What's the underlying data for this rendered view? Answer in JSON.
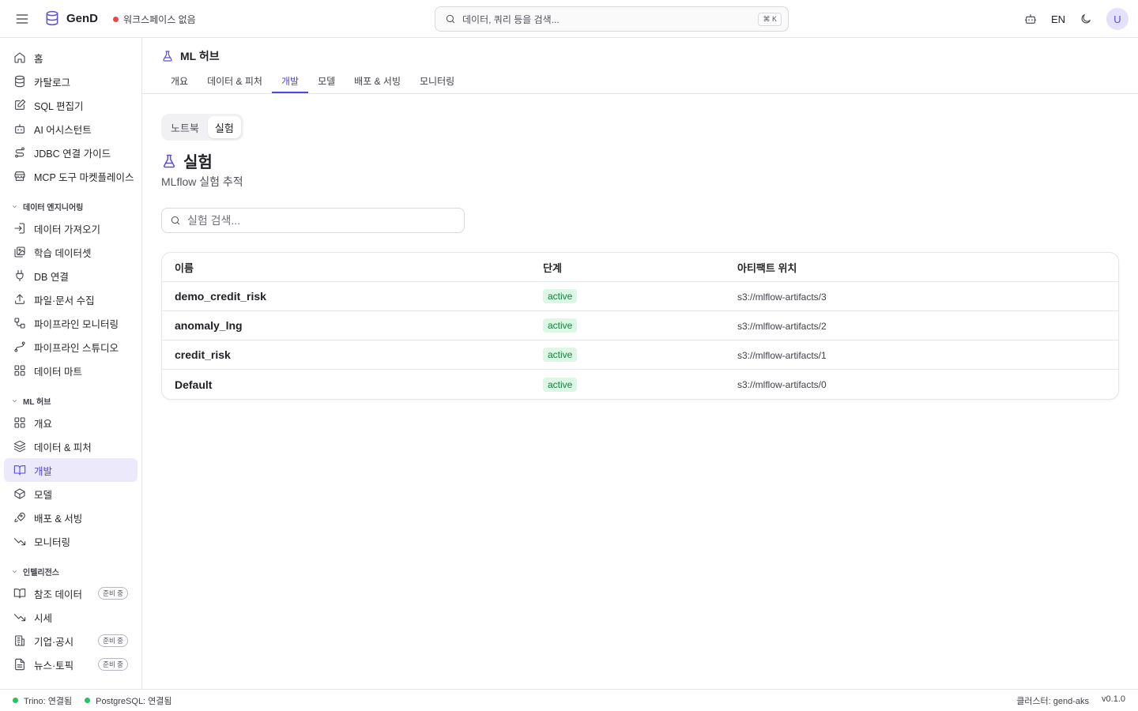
{
  "app": {
    "name": "GenD",
    "workspace": "워크스페이스 없음"
  },
  "search": {
    "placeholder": "데이터, 쿼리 등을 검색...",
    "shortcut": "⌘ K"
  },
  "header": {
    "lang": "EN",
    "avatar": "U"
  },
  "colors": {
    "accent": "#4f46e5",
    "active_bg": "#ece9fb",
    "status_ok": "#22c55e",
    "status_err": "#ef4444",
    "stage_bg": "#dcf7e3",
    "stage_text": "#15803d"
  },
  "sidebar": {
    "top_items": [
      {
        "label": "홈",
        "icon": "home-icon"
      },
      {
        "label": "카탈로그",
        "icon": "database-icon"
      },
      {
        "label": "SQL 편집기",
        "icon": "edit-icon"
      },
      {
        "label": "AI 어시스턴트",
        "icon": "bot-icon"
      },
      {
        "label": "JDBC 연결 가이드",
        "icon": "route-icon"
      },
      {
        "label": "MCP 도구 마켓플레이스",
        "icon": "store-icon"
      }
    ],
    "sections": [
      {
        "title": "데이터 엔지니어링",
        "items": [
          {
            "label": "데이터 가져오기",
            "icon": "import-icon"
          },
          {
            "label": "학습 데이터셋",
            "icon": "images-icon"
          },
          {
            "label": "DB 연결",
            "icon": "plug-icon"
          },
          {
            "label": "파일·문서 수집",
            "icon": "upload-icon"
          },
          {
            "label": "파이프라인 모니터링",
            "icon": "workflow-icon"
          },
          {
            "label": "파이프라인 스튜디오",
            "icon": "spline-icon"
          },
          {
            "label": "데이터 마트",
            "icon": "grid-icon"
          }
        ]
      },
      {
        "title": "ML 허브",
        "items": [
          {
            "label": "개요",
            "icon": "grid-icon"
          },
          {
            "label": "데이터 & 피처",
            "icon": "layers-icon"
          },
          {
            "label": "개발",
            "icon": "book-open-icon",
            "active": true
          },
          {
            "label": "모델",
            "icon": "box-icon"
          },
          {
            "label": "배포 & 서빙",
            "icon": "rocket-icon"
          },
          {
            "label": "모니터링",
            "icon": "trending-down-icon"
          }
        ]
      },
      {
        "title": "인텔리전스",
        "items": [
          {
            "label": "참조 데이터",
            "icon": "book-icon",
            "badge": "준비 중"
          },
          {
            "label": "시세",
            "icon": "trending-down-icon"
          },
          {
            "label": "기업·공시",
            "icon": "building-icon",
            "badge": "준비 중"
          },
          {
            "label": "뉴스·토픽",
            "icon": "file-text-icon",
            "badge": "준비 중"
          }
        ]
      }
    ]
  },
  "hub": {
    "title": "ML 허브",
    "tabs": [
      {
        "label": "개요"
      },
      {
        "label": "데이터 & 피처"
      },
      {
        "label": "개발",
        "active": true
      },
      {
        "label": "모델"
      },
      {
        "label": "배포 & 서빙"
      },
      {
        "label": "모니터링"
      }
    ]
  },
  "subtabs": [
    {
      "label": "노트북"
    },
    {
      "label": "실험",
      "active": true
    }
  ],
  "page": {
    "title": "실험",
    "subtitle": "MLflow 실험 추적",
    "search_placeholder": "실험 검색..."
  },
  "table": {
    "headers": [
      "이름",
      "단계",
      "아티팩트 위치"
    ],
    "rows": [
      {
        "name": "demo_credit_risk",
        "stage": "active",
        "location": "s3://mlflow-artifacts/3"
      },
      {
        "name": "anomaly_lng",
        "stage": "active",
        "location": "s3://mlflow-artifacts/2"
      },
      {
        "name": "credit_risk",
        "stage": "active",
        "location": "s3://mlflow-artifacts/1"
      },
      {
        "name": "Default",
        "stage": "active",
        "location": "s3://mlflow-artifacts/0"
      }
    ]
  },
  "status": {
    "trino": "Trino: 연결됨",
    "postgres": "PostgreSQL: 연결됨",
    "cluster": "클러스터: gend-aks",
    "version": "v0.1.0"
  }
}
